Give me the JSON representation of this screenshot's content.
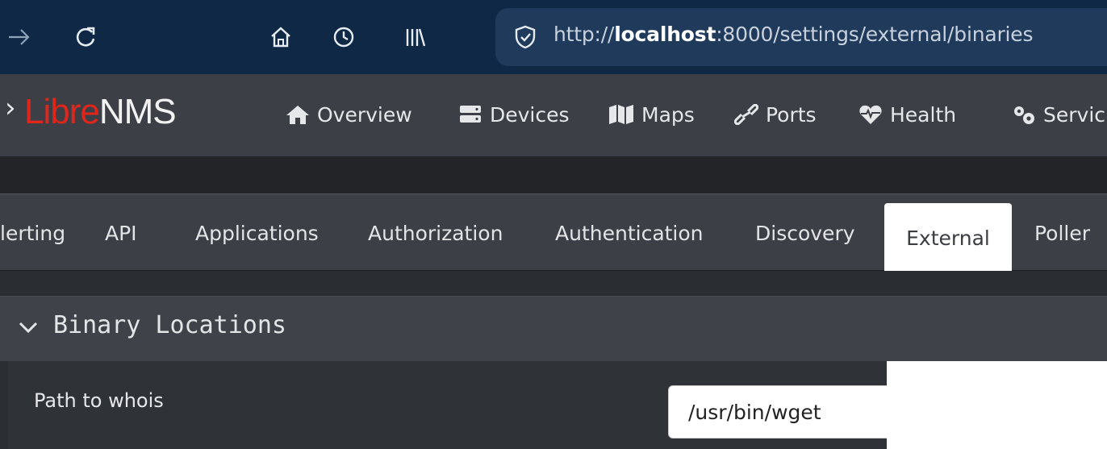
{
  "browser": {
    "url_prefix": "http://",
    "url_host": "localhost",
    "url_rest": ":8000/settings/external/binaries",
    "icons": [
      "forward-arrow-icon",
      "reload-icon",
      "home-icon",
      "history-icon",
      "library-icon",
      "shield-icon"
    ]
  },
  "navbar": {
    "brand_libre": "Libre",
    "brand_nms": "NMS",
    "menu": [
      {
        "label": "Overview",
        "icon": "home-icon"
      },
      {
        "label": "Devices",
        "icon": "server-icon"
      },
      {
        "label": "Maps",
        "icon": "map-icon"
      },
      {
        "label": "Ports",
        "icon": "link-icon"
      },
      {
        "label": "Health",
        "icon": "heartbeat-icon"
      },
      {
        "label": "Servic",
        "icon": "cogs-icon"
      }
    ]
  },
  "tabs": {
    "items": [
      "lerting",
      "API",
      "Applications",
      "Authorization",
      "Authentication",
      "Discovery",
      "External",
      "Poller"
    ],
    "active": "External"
  },
  "panel": {
    "title": "Binary Locations",
    "field_label": "Path to whois",
    "field_value": "/usr/bin/wget"
  },
  "colors": {
    "browser_bg": "#0e2846",
    "navbar_bg": "#3c4046",
    "brand_red": "#e0261b",
    "active_tab_bg": "#ffffff"
  }
}
